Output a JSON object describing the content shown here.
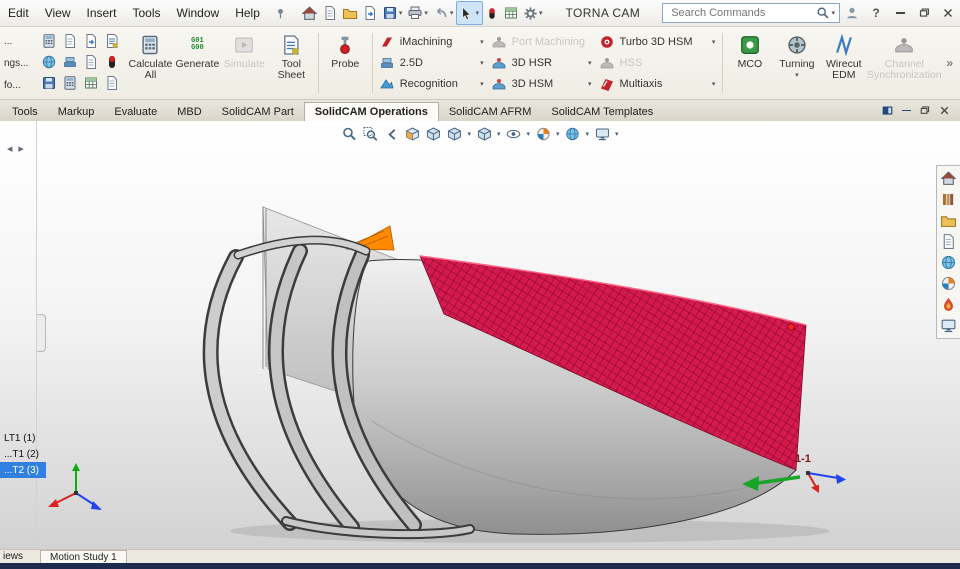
{
  "window": {
    "title": "TORNA CAM"
  },
  "menubar": {
    "items": [
      "Edit",
      "View",
      "Insert",
      "Tools",
      "Window",
      "Help"
    ],
    "search_placeholder": "Search Commands",
    "help_glyph": "?"
  },
  "ribbon": {
    "partials": [
      "...",
      "ngs...",
      "fo..."
    ],
    "calculate_all": "Calculate All",
    "generate": "Generate",
    "gcode_top": "G01",
    "gcode_bottom": "G00",
    "simulate": "Simulate",
    "tool_sheet": "Tool Sheet",
    "probe": "Probe",
    "imachining": "iMachining",
    "two_half_d": "2.5D",
    "recognition": "Recognition",
    "port_machining": "Port Machining",
    "hsr_3d": "3D HSR",
    "hsm_3d": "3D HSM",
    "turbo_3d_hsm": "Turbo 3D HSM",
    "hss": "HSS",
    "multiaxis": "Multiaxis",
    "mco": "MCO",
    "turning": "Turning",
    "wirecut_edm": "Wirecut EDM",
    "channel_sync": "Channel Synchronization",
    "overflow": "»"
  },
  "tabs": [
    {
      "label": "Tools"
    },
    {
      "label": "Markup"
    },
    {
      "label": "Evaluate"
    },
    {
      "label": "MBD"
    },
    {
      "label": "SolidCAM Part"
    },
    {
      "label": "SolidCAM Operations",
      "active": true
    },
    {
      "label": "SolidCAM AFRM"
    },
    {
      "label": "SolidCAM Templates"
    }
  ],
  "tree": {
    "items": [
      "LT1 (1)",
      "...T1 (2)",
      "...T2 (3)"
    ],
    "selected_index": 2
  },
  "viewport": {
    "coord_label": "1-1"
  },
  "statusbar": {
    "left_partial": "iews",
    "motion_tab": "Motion Study 1"
  },
  "colors": {
    "toolpath_mesh_red": "#d41a4e",
    "selection_blue": "#2f80e0",
    "highlight_orange": "#ff8a00",
    "statusbar_navy": "#1d2b4f"
  },
  "icons": {
    "menubar": [
      "home",
      "new-document",
      "open",
      "make-drawing",
      "save",
      "print",
      "undo",
      "select-cursor",
      "record",
      "table",
      "settings-gear",
      "user",
      "help",
      "minimize",
      "restore",
      "close"
    ],
    "hud": [
      "zoom-fit",
      "zoom-area",
      "previous-view",
      "section-view",
      "view-selector",
      "view-orientation",
      "display-style",
      "hide-show",
      "appearance",
      "scene",
      "view-settings"
    ],
    "task_pane": [
      "resources-home",
      "design-library",
      "file-explorer",
      "view-palette",
      "appearances",
      "scenes",
      "forum",
      "screen"
    ]
  }
}
